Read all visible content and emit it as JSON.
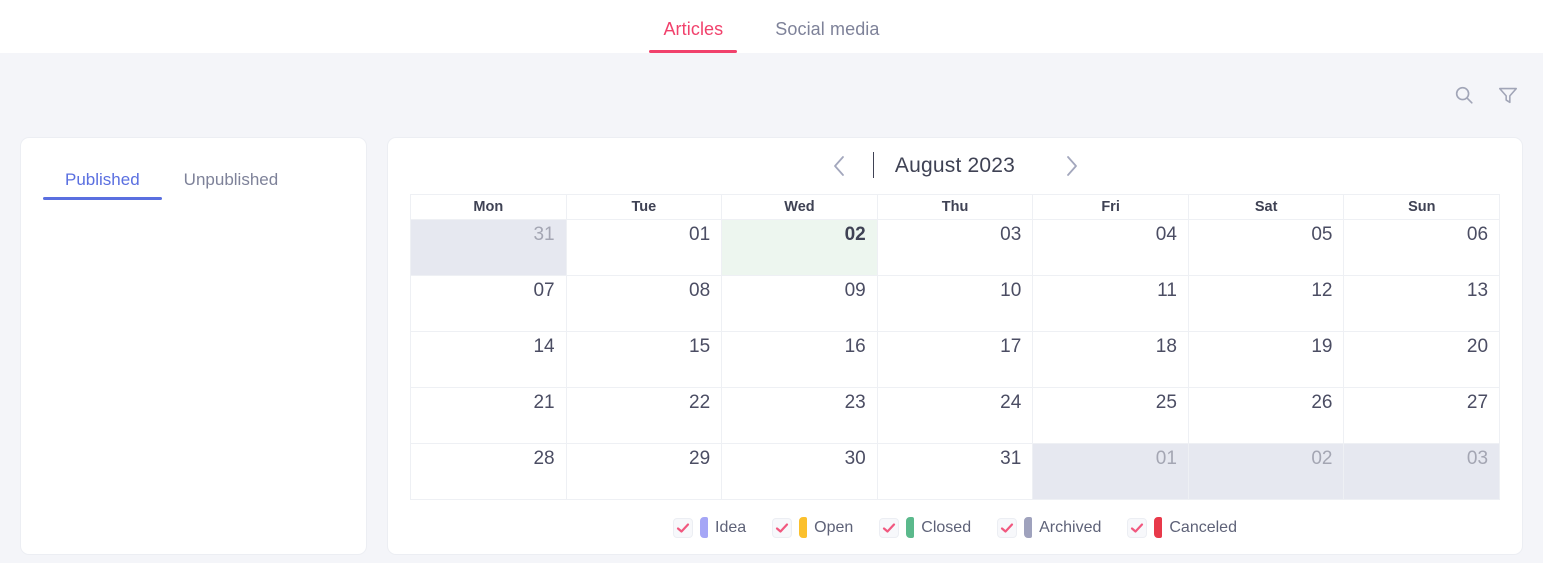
{
  "topbar": {
    "tabs": [
      {
        "label": "Articles",
        "active": true
      },
      {
        "label": "Social media",
        "active": false
      }
    ]
  },
  "toolbar": {
    "icons": [
      {
        "name": "search-icon",
        "label": "Search"
      },
      {
        "name": "filter-icon",
        "label": "Filter"
      }
    ]
  },
  "left_panel": {
    "tabs": [
      {
        "label": "Published",
        "active": true
      },
      {
        "label": "Unpublished",
        "active": false
      }
    ]
  },
  "calendar": {
    "title": "August 2023",
    "prev_label": "‹",
    "next_label": "›",
    "day_headers": [
      "Mon",
      "Tue",
      "Wed",
      "Thu",
      "Fri",
      "Sat",
      "Sun"
    ],
    "weeks": [
      [
        {
          "day": "31",
          "type": "other"
        },
        {
          "day": "01",
          "type": "current"
        },
        {
          "day": "02",
          "type": "today"
        },
        {
          "day": "03",
          "type": "current"
        },
        {
          "day": "04",
          "type": "current"
        },
        {
          "day": "05",
          "type": "current"
        },
        {
          "day": "06",
          "type": "current"
        }
      ],
      [
        {
          "day": "07",
          "type": "current"
        },
        {
          "day": "08",
          "type": "current"
        },
        {
          "day": "09",
          "type": "current"
        },
        {
          "day": "10",
          "type": "current"
        },
        {
          "day": "11",
          "type": "current"
        },
        {
          "day": "12",
          "type": "current"
        },
        {
          "day": "13",
          "type": "current"
        }
      ],
      [
        {
          "day": "14",
          "type": "current"
        },
        {
          "day": "15",
          "type": "current"
        },
        {
          "day": "16",
          "type": "current"
        },
        {
          "day": "17",
          "type": "current"
        },
        {
          "day": "18",
          "type": "current"
        },
        {
          "day": "19",
          "type": "current"
        },
        {
          "day": "20",
          "type": "current"
        }
      ],
      [
        {
          "day": "21",
          "type": "current"
        },
        {
          "day": "22",
          "type": "current"
        },
        {
          "day": "23",
          "type": "current"
        },
        {
          "day": "24",
          "type": "current"
        },
        {
          "day": "25",
          "type": "current"
        },
        {
          "day": "26",
          "type": "current"
        },
        {
          "day": "27",
          "type": "current"
        }
      ],
      [
        {
          "day": "28",
          "type": "current"
        },
        {
          "day": "29",
          "type": "current"
        },
        {
          "day": "30",
          "type": "current"
        },
        {
          "day": "31",
          "type": "current"
        },
        {
          "day": "01",
          "type": "other"
        },
        {
          "day": "02",
          "type": "other"
        },
        {
          "day": "03",
          "type": "other"
        }
      ]
    ]
  },
  "legend": {
    "items": [
      {
        "label": "Idea",
        "color": "#a5a6f6",
        "checked": true
      },
      {
        "label": "Open",
        "color": "#fbc02d",
        "checked": true
      },
      {
        "label": "Closed",
        "color": "#5bb98c",
        "checked": true
      },
      {
        "label": "Archived",
        "color": "#9fa2bd",
        "checked": true
      },
      {
        "label": "Canceled",
        "color": "#e8394a",
        "checked": true
      }
    ]
  },
  "colors": {
    "accent_pink": "#f1416c",
    "accent_blue": "#5a6fe0",
    "page_bg": "#f4f5f9",
    "other_month_bg": "#e6e8f0",
    "today_bg": "#edf6ef"
  }
}
